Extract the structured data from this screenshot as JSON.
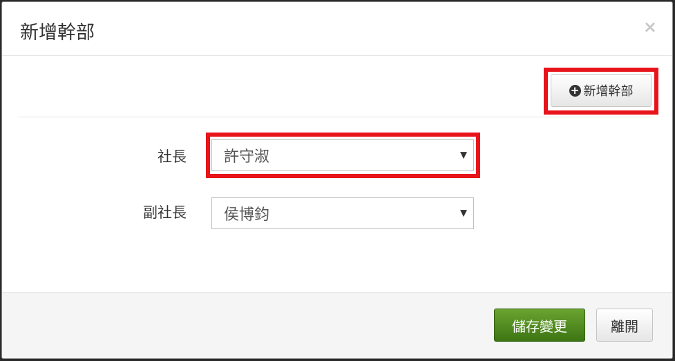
{
  "modal": {
    "title": "新增幹部",
    "close_symbol": "×"
  },
  "toolbar": {
    "add_button_label": "新增幹部",
    "add_icon": "plus-circle-icon"
  },
  "form": {
    "fields": [
      {
        "label": "社長",
        "value": "許守淑"
      },
      {
        "label": "副社長",
        "value": "侯博鈞"
      }
    ],
    "caret_symbol": "▼"
  },
  "footer": {
    "save_label": "儲存變更",
    "leave_label": "離開"
  },
  "colors": {
    "highlight": "#e8141c",
    "save_button": "#4e8a1f"
  }
}
